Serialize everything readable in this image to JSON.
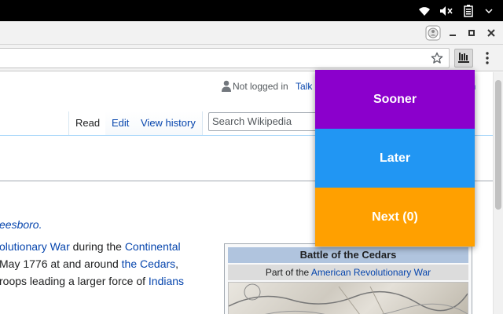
{
  "toolbar": {
    "bookmark_icon": "star-icon",
    "extension_icon": "queue-icon",
    "menu_icon": "vertical-dots-icon"
  },
  "wiki": {
    "personal": {
      "not_logged_in": "Not logged in",
      "talk": "Talk",
      "partial": "in"
    },
    "tabs": {
      "read": "Read",
      "edit": "Edit",
      "view_history": "View history"
    },
    "search_placeholder": "Search Wikipedia",
    "hatnote_fragment": "eesboro.",
    "lines": [
      {
        "a": "olutionary War",
        "b": " during the ",
        "c": "Continental"
      },
      {
        "a": "May 1776 at and around ",
        "b": "the Cedars",
        "c": ","
      },
      {
        "a": "roops leading a larger force of ",
        "b": "Indians"
      }
    ],
    "infobox": {
      "title": "Battle of the Cedars",
      "subtitle_prefix": "Part of the ",
      "subtitle_link": "American Revolutionary War"
    }
  },
  "popup": {
    "sooner": {
      "label": "Sooner",
      "color": "#8b00cc"
    },
    "later": {
      "label": "Later",
      "color": "#2196f3"
    },
    "next": {
      "label": "Next (0)",
      "color": "#ffa000"
    }
  }
}
